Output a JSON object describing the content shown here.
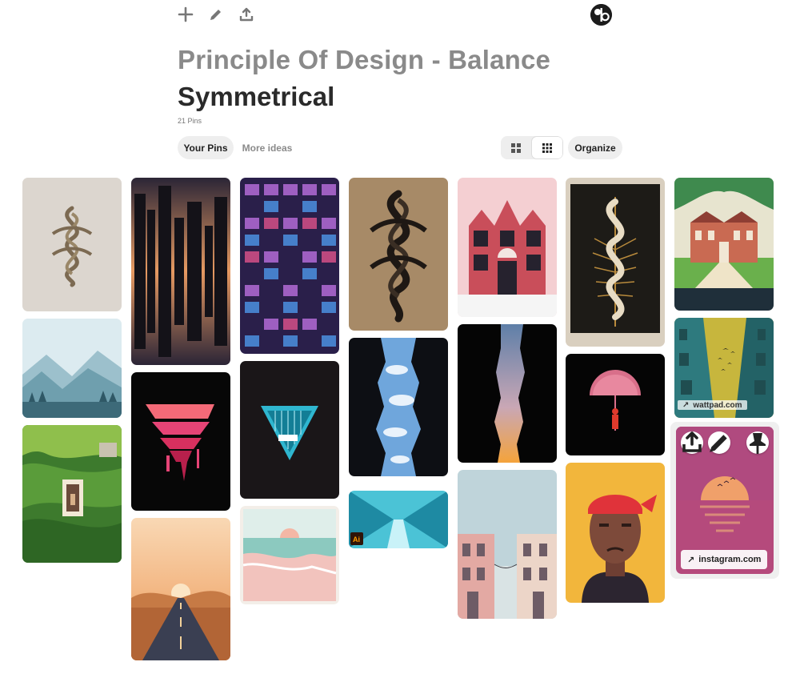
{
  "toolbar": {
    "add_icon": "plus-icon",
    "edit_icon": "pencil-icon",
    "share_icon": "share-icon"
  },
  "user": {
    "avatar_icon": "avatar-icon"
  },
  "board": {
    "parent_title": "Principle Of Design - Balance",
    "title": "Symmetrical",
    "pin_count": "21 Pins"
  },
  "tabs": {
    "your_pins": "Your Pins",
    "more_ideas": "More ideas"
  },
  "view_toggle": {
    "default_icon": "grid-large-icon",
    "compact_icon": "grid-compact-icon",
    "active": "compact"
  },
  "actions": {
    "organize": "Organize"
  },
  "pins": [
    {
      "name": "pin-snake-beige",
      "source": ""
    },
    {
      "name": "pin-mountains-blue",
      "source": ""
    },
    {
      "name": "pin-green-hills-illustration",
      "source": ""
    },
    {
      "name": "pin-city-reflection-sunset",
      "source": ""
    },
    {
      "name": "pin-pink-drip-reflection",
      "source": ""
    },
    {
      "name": "pin-desert-road",
      "source": ""
    },
    {
      "name": "pin-neon-apartments",
      "source": ""
    },
    {
      "name": "pin-cyan-inverted-triangle",
      "source": ""
    },
    {
      "name": "pin-pink-beach",
      "source": ""
    },
    {
      "name": "pin-snake-black-brown",
      "source": ""
    },
    {
      "name": "pin-sky-between-buildings",
      "source": ""
    },
    {
      "name": "pin-cyan-corridor",
      "source": ""
    },
    {
      "name": "pin-tudor-house-pink",
      "source": ""
    },
    {
      "name": "pin-sunset-between-buildings",
      "source": ""
    },
    {
      "name": "pin-pastel-townhouses",
      "source": ""
    },
    {
      "name": "pin-snake-fern-tarot",
      "source": ""
    },
    {
      "name": "pin-umbrella-silhouette",
      "source": ""
    },
    {
      "name": "pin-portrait-red-bandana",
      "source": ""
    },
    {
      "name": "pin-manor-house-park",
      "source": ""
    },
    {
      "name": "pin-teal-building-birds",
      "source": "wattpad.com"
    },
    {
      "name": "pin-pink-sunset-sea",
      "source": "instagram.com"
    }
  ],
  "pin_overlay": {
    "share_icon": "share-icon",
    "edit_icon": "pencil-icon",
    "pin_icon": "pushpin-icon",
    "link_icon": "arrow-up-right-icon"
  },
  "colors": {
    "accent_gray": "#8a8a8a",
    "chip_bg": "#eeeeee",
    "title_dark": "#2a2a2a"
  }
}
